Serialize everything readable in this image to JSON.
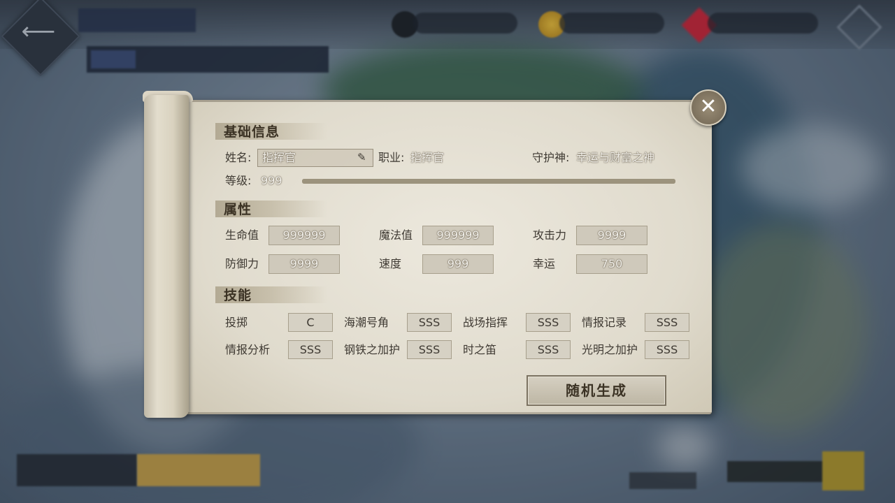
{
  "basic": {
    "heading": "基础信息",
    "name_label": "姓名:",
    "name_value": "指挥官",
    "job_label": "职业:",
    "job_value": "指挥官",
    "guardian_label": "守护神:",
    "guardian_value": "幸运与财富之神",
    "level_label": "等级:",
    "level_value": "999",
    "level_progress": 1.0
  },
  "attributes": {
    "heading": "属性",
    "items": [
      {
        "label": "生命值",
        "value": "999999"
      },
      {
        "label": "魔法值",
        "value": "999999"
      },
      {
        "label": "攻击力",
        "value": "9999"
      },
      {
        "label": "防御力",
        "value": "9999"
      },
      {
        "label": "速度",
        "value": "999"
      },
      {
        "label": "幸运",
        "value": "750"
      }
    ]
  },
  "skills": {
    "heading": "技能",
    "items": [
      {
        "name": "投掷",
        "grade": "C"
      },
      {
        "name": "海潮号角",
        "grade": "SSS"
      },
      {
        "name": "战场指挥",
        "grade": "SSS"
      },
      {
        "name": "情报记录",
        "grade": "SSS"
      },
      {
        "name": "情报分析",
        "grade": "SSS"
      },
      {
        "name": "钢铁之加护",
        "grade": "SSS"
      },
      {
        "name": "时之笛",
        "grade": "SSS"
      },
      {
        "name": "光明之加护",
        "grade": "SSS"
      }
    ]
  },
  "random_button": "随机生成",
  "icons": {
    "close": "close-icon",
    "edit": "pencil-icon",
    "back": "back-arrow-icon"
  },
  "colors": {
    "parchment": "#e6e1d4",
    "heading_text": "#3b3224",
    "value_text": "#f4f2ec"
  }
}
